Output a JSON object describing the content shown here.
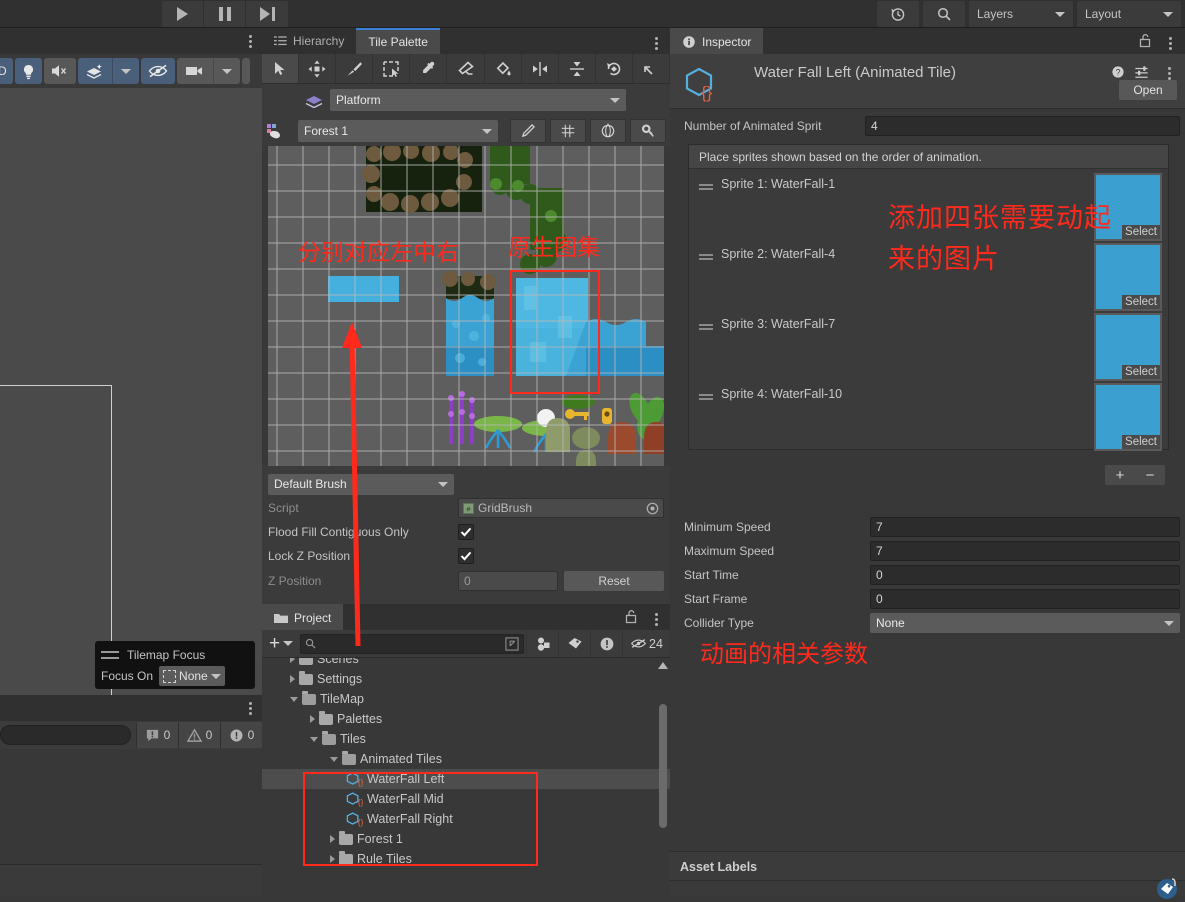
{
  "toolbar": {
    "play_icon": "play-icon",
    "pause_icon": "pause-icon",
    "step_icon": "step-icon",
    "history_icon": "history-icon",
    "search_icon": "search-icon",
    "layers_label": "Layers",
    "layout_label": "Layout"
  },
  "scene_toolbar": {
    "buttons": [
      {
        "name": "2d-toggle",
        "label": "D",
        "icon": "2d-icon",
        "active": true
      },
      {
        "name": "lighting-toggle",
        "label": "",
        "icon": "lightbulb-icon",
        "active": true
      },
      {
        "name": "audio-toggle",
        "label": "",
        "icon": "speaker-mute-icon",
        "active": false
      },
      {
        "name": "effects-toggle",
        "label": "",
        "icon": "fx-sparkle-icon",
        "active": true
      },
      {
        "name": "effects-dropdown",
        "label": "",
        "icon": "chevron-down-icon",
        "active": true
      },
      {
        "name": "hidden-objects-toggle",
        "label": "",
        "icon": "eye-slash-icon",
        "active": true
      },
      {
        "name": "camera-toggle",
        "label": "",
        "icon": "camera-icon",
        "active": false
      },
      {
        "name": "camera-dropdown",
        "label": "",
        "icon": "chevron-down-icon",
        "active": false
      }
    ]
  },
  "tilemap_focus": {
    "title": "Tilemap Focus",
    "focus_on_label": "Focus On",
    "focus_on_value": "None",
    "grip_icon": "drag-handle-icon",
    "dropdown_icon": "chevron-down-icon",
    "target_icon": "target-brackets-icon"
  },
  "console": {
    "search_placeholder": "",
    "search_value": "",
    "badges": [
      {
        "icon": "log-icon",
        "count": "0"
      },
      {
        "icon": "warning-icon",
        "count": "0"
      },
      {
        "icon": "error-icon",
        "count": "0"
      }
    ],
    "kebab_icon": "kebab-menu-icon"
  },
  "center_panel": {
    "tabs": [
      {
        "name": "tab-hierarchy",
        "label": "Hierarchy",
        "icon": "hierarchy-icon",
        "active": false
      },
      {
        "name": "tab-tile-palette",
        "label": "Tile Palette",
        "icon": "",
        "active": true
      }
    ],
    "kebab_icon": "kebab-menu-icon",
    "tools": [
      {
        "name": "tool-select",
        "icon": "cursor-arrow-icon",
        "selected": true
      },
      {
        "name": "tool-move",
        "icon": "move-arrows-icon",
        "selected": false
      },
      {
        "name": "tool-paint",
        "icon": "paintbrush-icon",
        "selected": false
      },
      {
        "name": "tool-box-fill",
        "icon": "box-select-icon",
        "selected": false
      },
      {
        "name": "tool-picker",
        "icon": "eyedropper-icon",
        "selected": false
      },
      {
        "name": "tool-erase",
        "icon": "eraser-icon",
        "selected": false
      },
      {
        "name": "tool-fill",
        "icon": "paint-bucket-icon",
        "selected": false
      },
      {
        "name": "tool-flip-x",
        "icon": "flip-horizontal-icon",
        "selected": false
      },
      {
        "name": "tool-flip-y",
        "icon": "flip-vertical-icon",
        "selected": false
      },
      {
        "name": "tool-rotate-cw",
        "icon": "rotate-clockwise-icon",
        "selected": false
      },
      {
        "name": "tool-rotate-ccw",
        "icon": "rotate-counterclockwise-icon",
        "selected": false
      }
    ],
    "active_target_label": "Platform",
    "active_target_icon": "layers-stack-icon",
    "palette_name": "Forest 1",
    "palette_icon": "palette-icon",
    "right_buttons": [
      {
        "name": "edit-palette-button",
        "icon": "pencil-icon"
      },
      {
        "name": "grid-toggle-button",
        "icon": "grid-icon"
      },
      {
        "name": "gizmo-button",
        "icon": "globe-gizmo-icon"
      },
      {
        "name": "settings-button",
        "icon": "gear-wand-icon"
      }
    ]
  },
  "brush": {
    "selected": "Default Brush",
    "script_label": "Script",
    "script_value": "GridBrush",
    "script_icon": "script-asset-icon",
    "object_picker_icon": "radio-target-icon",
    "flood_fill_label": "Flood Fill Contiguous Only",
    "flood_fill_checked": true,
    "lock_z_label": "Lock Z Position",
    "lock_z_checked": true,
    "z_position_label": "Z Position",
    "z_position_value": "0",
    "reset_label": "Reset",
    "check_icon": "checkmark-icon",
    "dropdown_icon": "chevron-down-icon"
  },
  "project_panel": {
    "tab_label": "Project",
    "tab_icon": "folder-icon",
    "lock_icon": "lock-open-icon",
    "kebab_icon": "kebab-menu-icon",
    "add_label": "+",
    "add_dropdown_icon": "chevron-down-icon",
    "search_placeholder": "",
    "search_value": "",
    "search_icon": "search-icon",
    "search_expand_icon": "expand-search-icon",
    "toolbar_buttons": [
      {
        "name": "filter-by-type-button",
        "icon": "object-filter-icon",
        "label": ""
      },
      {
        "name": "filter-by-label-button",
        "icon": "tag-icon",
        "label": ""
      },
      {
        "name": "warnings-filter-button",
        "icon": "error-circle-icon",
        "label": ""
      },
      {
        "name": "hidden-packages-button",
        "icon": "eye-slash-icon",
        "label": "24"
      }
    ],
    "tree": [
      {
        "label": "Scenes",
        "depth": 1,
        "type": "folder",
        "expanded": false,
        "selected": false,
        "clipped": true
      },
      {
        "label": "Settings",
        "depth": 1,
        "type": "folder",
        "expanded": false,
        "selected": false
      },
      {
        "label": "TileMap",
        "depth": 1,
        "type": "folder-open",
        "expanded": true,
        "selected": false
      },
      {
        "label": "Palettes",
        "depth": 2,
        "type": "folder",
        "expanded": false,
        "selected": false
      },
      {
        "label": "Tiles",
        "depth": 2,
        "type": "folder-open",
        "expanded": true,
        "selected": false
      },
      {
        "label": "Animated Tiles",
        "depth": 3,
        "type": "folder-open",
        "expanded": true,
        "selected": false
      },
      {
        "label": "WaterFall Left",
        "depth": 4,
        "type": "asset",
        "expanded": false,
        "selected": true
      },
      {
        "label": "WaterFall Mid",
        "depth": 4,
        "type": "asset",
        "expanded": false,
        "selected": false
      },
      {
        "label": "WaterFall Right",
        "depth": 4,
        "type": "asset",
        "expanded": false,
        "selected": false
      },
      {
        "label": "Forest 1",
        "depth": 3,
        "type": "folder",
        "expanded": false,
        "selected": false
      },
      {
        "label": "Rule Tiles",
        "depth": 3,
        "type": "folder",
        "expanded": false,
        "selected": false
      }
    ]
  },
  "inspector": {
    "tab_label": "Inspector",
    "tab_icon": "info-icon",
    "lock_icon": "lock-open-icon",
    "kebab_icon": "kebab-menu-icon",
    "asset_title": "Water Fall Left (Animated Tile)",
    "asset_icon": "script-cube-icon",
    "help_icon": "help-icon",
    "preset_icon": "preset-icon",
    "header_kebab_icon": "kebab-menu-icon",
    "open_label": "Open",
    "count_label": "Number of Animated Sprit",
    "count_value": "4",
    "sprite_box_hint": "Place sprites shown based on the order of animation.",
    "sprites": [
      {
        "label": "Sprite 1: WaterFall-1",
        "select_label": "Select",
        "grip_icon": "drag-handle-icon"
      },
      {
        "label": "Sprite 2: WaterFall-4",
        "select_label": "Select",
        "grip_icon": "drag-handle-icon"
      },
      {
        "label": "Sprite 3: WaterFall-7",
        "select_label": "Select",
        "grip_icon": "drag-handle-icon"
      },
      {
        "label": "Sprite 4: WaterFall-10",
        "select_label": "Select",
        "grip_icon": "drag-handle-icon"
      }
    ],
    "add_label": "+",
    "remove_label": "−",
    "fields": [
      {
        "label": "Minimum Speed",
        "value": "7",
        "type": "text"
      },
      {
        "label": "Maximum Speed",
        "value": "7",
        "type": "text"
      },
      {
        "label": "Start Time",
        "value": "0",
        "type": "text"
      },
      {
        "label": "Start Frame",
        "value": "0",
        "type": "text"
      },
      {
        "label": "Collider Type",
        "value": "None",
        "type": "select"
      }
    ],
    "asset_labels_title": "Asset Labels",
    "asset_label_tag_icon": "tag-icon"
  },
  "annotations": {
    "color": "#ff2a1c",
    "palette_left_mid_right": "分别对应左中右",
    "palette_source_atlas": "原生图集",
    "inspector_add_four": "添加四张需要动起",
    "inspector_add_four_2": "来的图片",
    "inspector_params": "动画的相关参数"
  }
}
